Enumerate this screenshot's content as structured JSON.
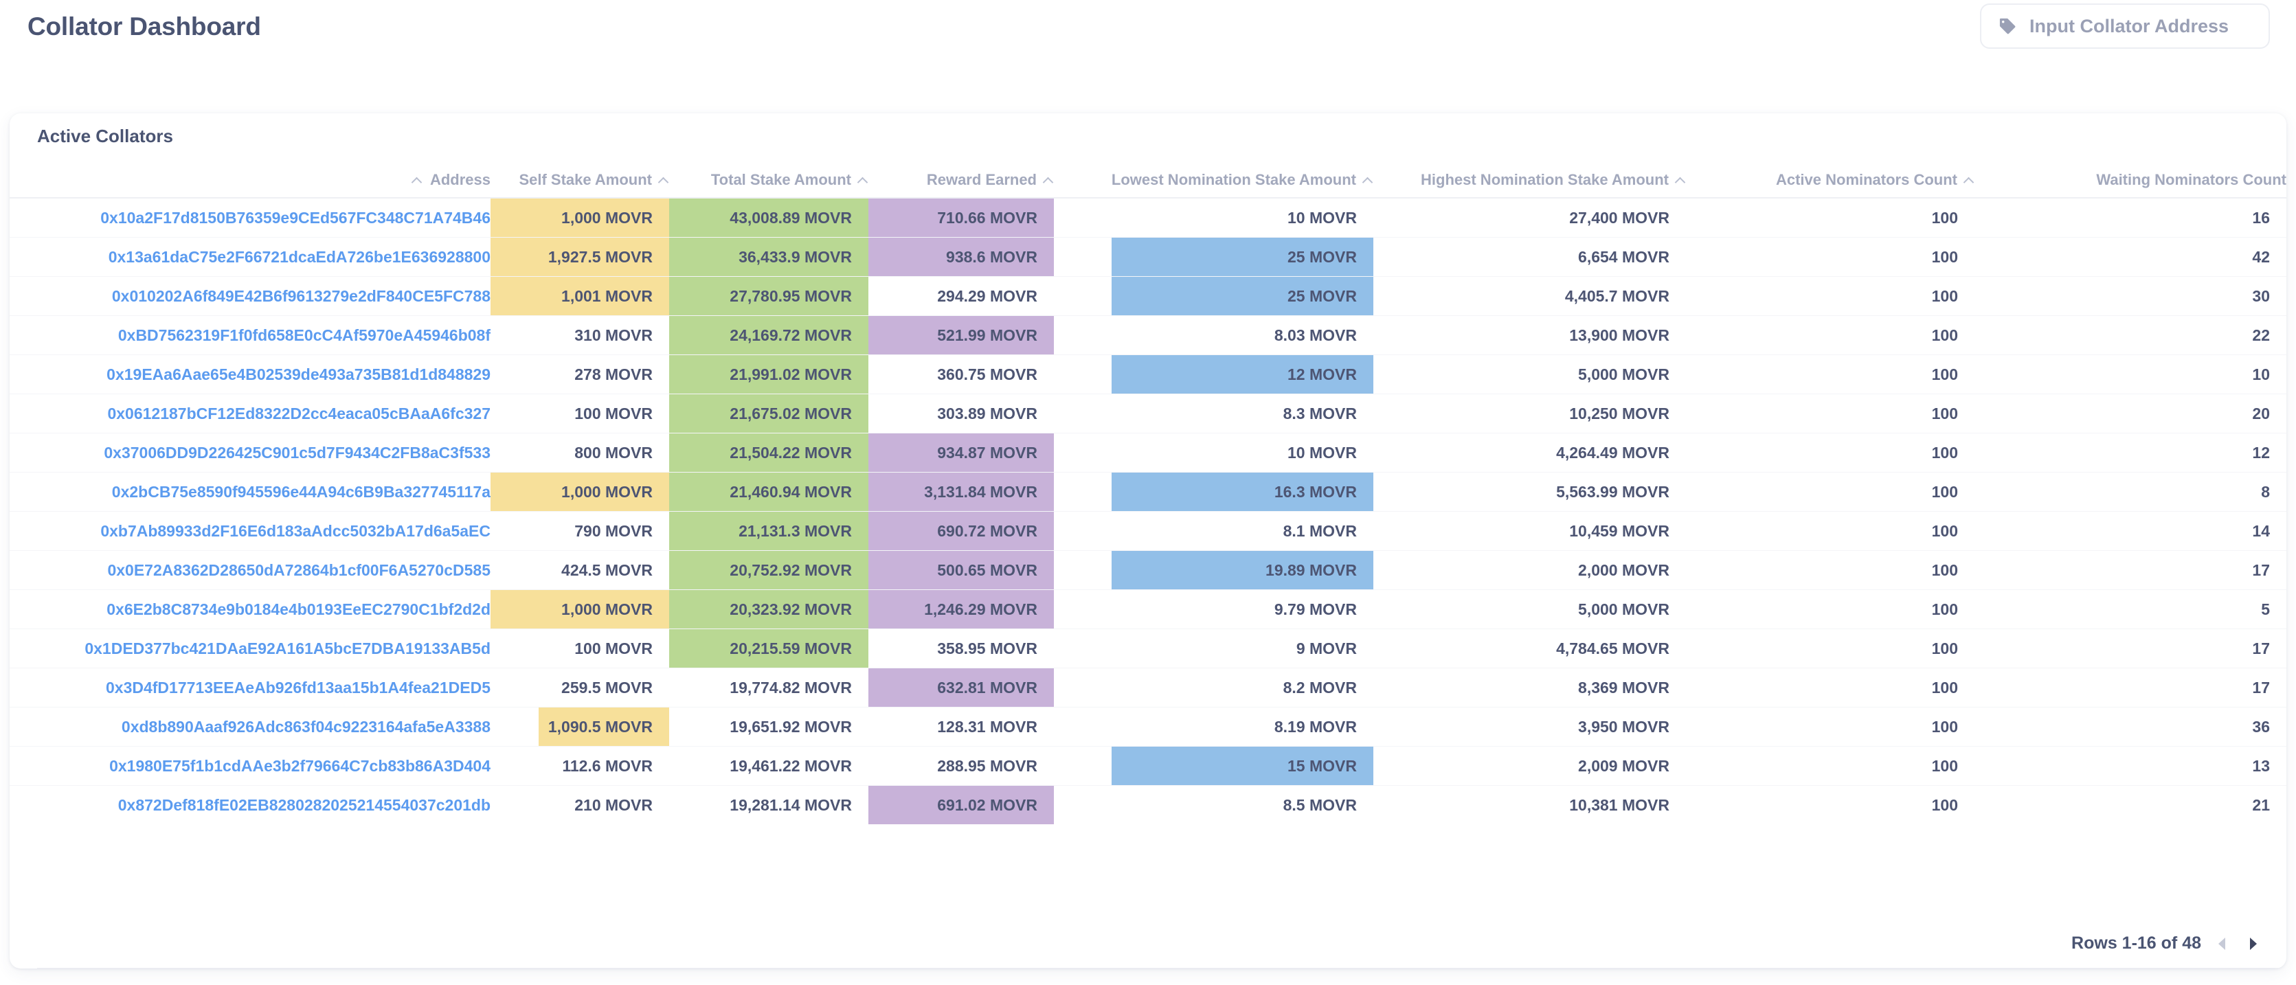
{
  "header": {
    "title": "Collator Dashboard",
    "address_input": {
      "placeholder": "Input Collator Address",
      "icon": "tag-icon"
    }
  },
  "card": {
    "title": "Active Collators",
    "columns": [
      {
        "key": "address",
        "label": "Address",
        "sortable": true,
        "align": "left"
      },
      {
        "key": "self",
        "label": "Self Stake Amount",
        "sortable": true,
        "align": "right"
      },
      {
        "key": "total",
        "label": "Total Stake Amount",
        "sortable": true,
        "align": "right"
      },
      {
        "key": "reward",
        "label": "Reward Earned",
        "sortable": true,
        "align": "right"
      },
      {
        "key": "lowest",
        "label": "Lowest Nomination Stake Amount",
        "sortable": true,
        "align": "right"
      },
      {
        "key": "highest",
        "label": "Highest Nomination Stake Amount",
        "sortable": true,
        "align": "right"
      },
      {
        "key": "active",
        "label": "Active Nominators Count",
        "sortable": true,
        "align": "right"
      },
      {
        "key": "waiting",
        "label": "Waiting Nominators Count",
        "sortable": false,
        "align": "right"
      }
    ],
    "highlight_colors": {
      "self_stake": "#f7e09a",
      "total_stake": "#b9d893",
      "reward_earned": "#c8b2d9",
      "lowest_nomination": "#92bfe8",
      "none": "transparent"
    },
    "rows": [
      {
        "address": "0x10a2F17d8150B76359e9CEd567FC348C71A74B46",
        "self": "1,000 MOVR",
        "self_fill": 100,
        "total": "43,008.89 MOVR",
        "total_fill": 100,
        "reward": "710.66 MOVR",
        "reward_fill": 100,
        "lowest": "10 MOVR",
        "lowest_fill": 0,
        "highest": "27,400 MOVR",
        "active": "100",
        "waiting": "16"
      },
      {
        "address": "0x13a61daC75e2F66721dcaEdA726be1E636928800",
        "self": "1,927.5 MOVR",
        "self_fill": 100,
        "total": "36,433.9 MOVR",
        "total_fill": 100,
        "reward": "938.6 MOVR",
        "reward_fill": 100,
        "lowest": "25 MOVR",
        "lowest_fill": 82,
        "highest": "6,654 MOVR",
        "active": "100",
        "waiting": "42"
      },
      {
        "address": "0x010202A6f849E42B6f9613279e2dF840CE5FC788",
        "self": "1,001 MOVR",
        "self_fill": 100,
        "total": "27,780.95 MOVR",
        "total_fill": 100,
        "reward": "294.29 MOVR",
        "reward_fill": 0,
        "lowest": "25 MOVR",
        "lowest_fill": 82,
        "highest": "4,405.7 MOVR",
        "active": "100",
        "waiting": "30"
      },
      {
        "address": "0xBD7562319F1f0fd658E0cC4Af5970eA45946b08f",
        "self": "310 MOVR",
        "self_fill": 0,
        "total": "24,169.72 MOVR",
        "total_fill": 100,
        "reward": "521.99 MOVR",
        "reward_fill": 100,
        "lowest": "8.03 MOVR",
        "lowest_fill": 0,
        "highest": "13,900 MOVR",
        "active": "100",
        "waiting": "22"
      },
      {
        "address": "0x19EAa6Aae65e4B02539de493a735B81d1d848829",
        "self": "278 MOVR",
        "self_fill": 0,
        "total": "21,991.02 MOVR",
        "total_fill": 100,
        "reward": "360.75 MOVR",
        "reward_fill": 0,
        "lowest": "12 MOVR",
        "lowest_fill": 82,
        "highest": "5,000 MOVR",
        "active": "100",
        "waiting": "10"
      },
      {
        "address": "0x0612187bCF12Ed8322D2cc4eaca05cBAaA6fc327",
        "self": "100 MOVR",
        "self_fill": 0,
        "total": "21,675.02 MOVR",
        "total_fill": 100,
        "reward": "303.89 MOVR",
        "reward_fill": 0,
        "lowest": "8.3 MOVR",
        "lowest_fill": 0,
        "highest": "10,250 MOVR",
        "active": "100",
        "waiting": "20"
      },
      {
        "address": "0x37006DD9D226425C901c5d7F9434C2FB8aC3f533",
        "self": "800 MOVR",
        "self_fill": 0,
        "total": "21,504.22 MOVR",
        "total_fill": 100,
        "reward": "934.87 MOVR",
        "reward_fill": 100,
        "lowest": "10 MOVR",
        "lowest_fill": 0,
        "highest": "4,264.49 MOVR",
        "active": "100",
        "waiting": "12"
      },
      {
        "address": "0x2bCB75e8590f945596e44A94c6B9Ba327745117a",
        "self": "1,000 MOVR",
        "self_fill": 100,
        "total": "21,460.94 MOVR",
        "total_fill": 100,
        "reward": "3,131.84 MOVR",
        "reward_fill": 100,
        "lowest": "16.3 MOVR",
        "lowest_fill": 82,
        "highest": "5,563.99 MOVR",
        "active": "100",
        "waiting": "8"
      },
      {
        "address": "0xb7Ab89933d2F16E6d183aAdcc5032bA17d6a5aEC",
        "self": "790 MOVR",
        "self_fill": 0,
        "total": "21,131.3 MOVR",
        "total_fill": 100,
        "reward": "690.72 MOVR",
        "reward_fill": 100,
        "lowest": "8.1 MOVR",
        "lowest_fill": 0,
        "highest": "10,459 MOVR",
        "active": "100",
        "waiting": "14"
      },
      {
        "address": "0x0E72A8362D28650dA72864b1cf00F6A5270cD585",
        "self": "424.5 MOVR",
        "self_fill": 0,
        "total": "20,752.92 MOVR",
        "total_fill": 100,
        "reward": "500.65 MOVR",
        "reward_fill": 100,
        "lowest": "19.89 MOVR",
        "lowest_fill": 82,
        "highest": "2,000 MOVR",
        "active": "100",
        "waiting": "17"
      },
      {
        "address": "0x6E2b8C8734e9b0184e4b0193EeEC2790C1bf2d2d",
        "self": "1,000 MOVR",
        "self_fill": 100,
        "total": "20,323.92 MOVR",
        "total_fill": 100,
        "reward": "1,246.29 MOVR",
        "reward_fill": 100,
        "lowest": "9.79 MOVR",
        "lowest_fill": 0,
        "highest": "5,000 MOVR",
        "active": "100",
        "waiting": "5"
      },
      {
        "address": "0x1DED377bc421DAaE92A161A5bcE7DBA19133AB5d",
        "self": "100 MOVR",
        "self_fill": 0,
        "total": "20,215.59 MOVR",
        "total_fill": 100,
        "reward": "358.95 MOVR",
        "reward_fill": 0,
        "lowest": "9 MOVR",
        "lowest_fill": 0,
        "highest": "4,784.65 MOVR",
        "active": "100",
        "waiting": "17"
      },
      {
        "address": "0x3D4fD17713EEAeAb926fd13aa15b1A4fea21DED5",
        "self": "259.5 MOVR",
        "self_fill": 0,
        "total": "19,774.82 MOVR",
        "total_fill": 0,
        "reward": "632.81 MOVR",
        "reward_fill": 100,
        "lowest": "8.2 MOVR",
        "lowest_fill": 0,
        "highest": "8,369 MOVR",
        "active": "100",
        "waiting": "17"
      },
      {
        "address": "0xd8b890Aaaf926Adc863f04c9223164afa5eA3388",
        "self": "1,090.5 MOVR",
        "self_fill": 73,
        "total": "19,651.92 MOVR",
        "total_fill": 0,
        "reward": "128.31 MOVR",
        "reward_fill": 0,
        "lowest": "8.19 MOVR",
        "lowest_fill": 0,
        "highest": "3,950 MOVR",
        "active": "100",
        "waiting": "36"
      },
      {
        "address": "0x1980E75f1b1cdAAe3b2f79664C7cb83b86A3D404",
        "self": "112.6 MOVR",
        "self_fill": 0,
        "total": "19,461.22 MOVR",
        "total_fill": 0,
        "reward": "288.95 MOVR",
        "reward_fill": 0,
        "lowest": "15 MOVR",
        "lowest_fill": 82,
        "highest": "2,009 MOVR",
        "active": "100",
        "waiting": "13"
      },
      {
        "address": "0x872Def818fE02EB8280282025214554037c201db",
        "self": "210 MOVR",
        "self_fill": 0,
        "total": "19,281.14 MOVR",
        "total_fill": 0,
        "reward": "691.02 MOVR",
        "reward_fill": 100,
        "lowest": "8.5 MOVR",
        "lowest_fill": 0,
        "highest": "10,381 MOVR",
        "active": "100",
        "waiting": "21"
      }
    ],
    "pagination": {
      "label": "Rows 1-16 of 48",
      "prev_icon": "chevron-left-icon",
      "next_icon": "chevron-right-icon",
      "prev_enabled": false,
      "next_enabled": true
    }
  }
}
